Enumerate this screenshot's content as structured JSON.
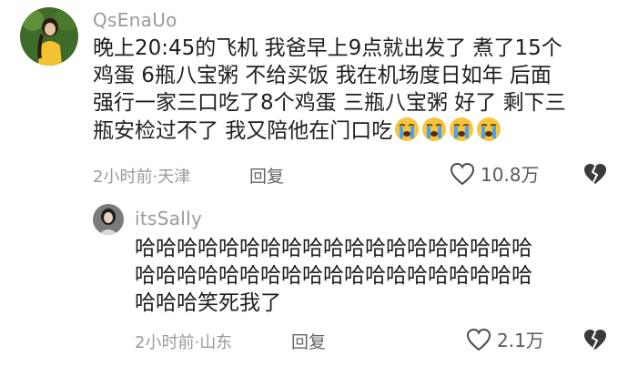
{
  "comments": [
    {
      "username": "QsEnaUo",
      "text_lines": [
        "晚上20:45的飞机 我爸早上9点就出发了 煮了15个",
        "鸡蛋 6瓶八宝粥 不给买饭 我在机场度日如年 后面",
        "强行一家三口吃了8个鸡蛋 三瓶八宝粥 好了 剩下三",
        "瓶安检过不了 我又陪他在门口吃"
      ],
      "emojis": [
        "crying-emoji",
        "crying-emoji",
        "crying-emoji",
        "crying-emoji"
      ],
      "time": "2小时前",
      "separator": "·",
      "location": "天津",
      "reply_label": "回复",
      "like_count": "10.8万"
    },
    {
      "username": "itsSally",
      "text_lines": [
        "哈哈哈哈哈哈哈哈哈哈哈哈哈哈哈哈哈哈哈",
        "哈哈哈哈哈哈哈哈哈哈哈哈哈哈哈哈哈哈哈",
        "哈哈哈笑死我了"
      ],
      "time": "2小时前",
      "separator": "·",
      "location": "山东",
      "reply_label": "回复",
      "like_count": "2.1万"
    }
  ],
  "colors": {
    "meta_gray": "#9a9a9a",
    "text": "#1e1e1e",
    "emoji_yellow": "#f7c43b",
    "tear_blue": "#4aa3f0"
  }
}
